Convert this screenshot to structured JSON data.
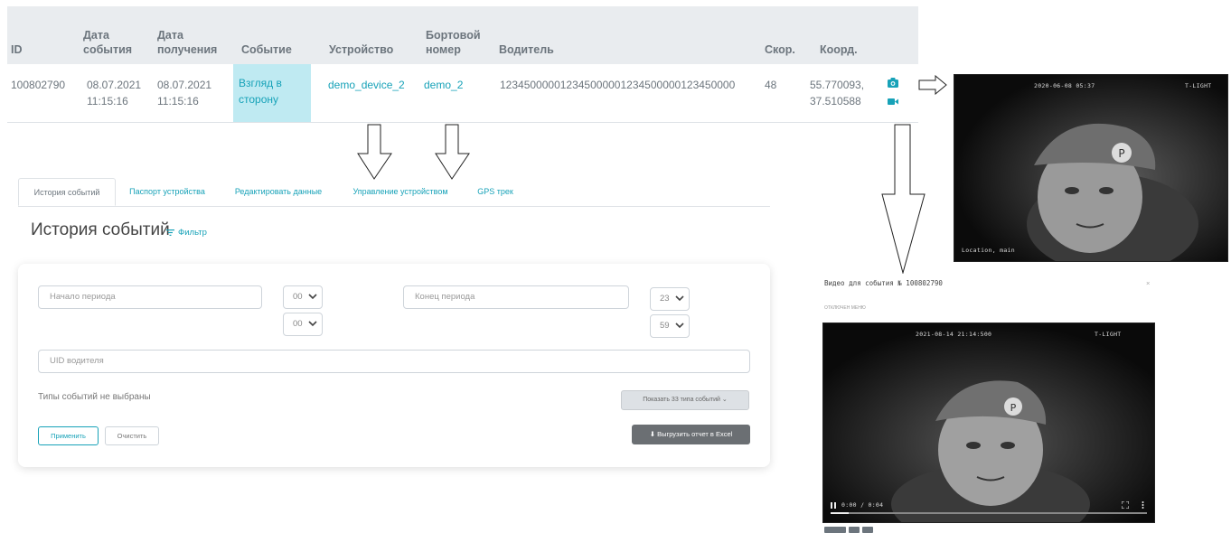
{
  "table": {
    "headers": {
      "id": "ID",
      "event_date_1": "Дата",
      "event_date_2": "события",
      "recv_date_1": "Дата",
      "recv_date_2": "получения",
      "event": "Событие",
      "device": "Устройство",
      "board_1": "Бортовой",
      "board_2": "номер",
      "driver": "Водитель",
      "speed": "Скор.",
      "coords": "Коорд."
    },
    "row": {
      "id": "100802790",
      "event_date": "08.07.2021",
      "event_time": "11:15:16",
      "recv_date": "08.07.2021",
      "recv_time": "11:15:16",
      "event_1": "Взгляд в",
      "event_2": "сторону",
      "device": "demo_device_2",
      "board": "demo_2",
      "driver": "123450000012345000001234500000123450000",
      "speed": "48",
      "lat": "55.770093,",
      "lon": "37.510588"
    }
  },
  "tabs": [
    {
      "label": "История событий"
    },
    {
      "label": "Паспорт устройства"
    },
    {
      "label": "Редактировать данные"
    },
    {
      "label": "Управление устройством"
    },
    {
      "label": "GPS трек"
    }
  ],
  "section": {
    "title": "История событий",
    "filter": "Фильтр"
  },
  "filter": {
    "start_placeholder": "Начало периода",
    "end_placeholder": "Конец периода",
    "start_hour": "00",
    "start_min": "00",
    "end_hour": "23",
    "end_min": "59",
    "uid_placeholder": "UID водителя",
    "types_text": "Типы событий не выбраны",
    "types_button": "Показать 33 типа событий ⌄",
    "apply": "Применить",
    "clear": "Очистить",
    "excel": "⬇ Выгрузить отчет в Excel"
  },
  "photo_top": {
    "timestamp": "2020-06-08 05:37",
    "corner": "T-LIGHT",
    "caption": "Location, main"
  },
  "modal": {
    "title": "Видео для события № 100802790",
    "close": "×",
    "subtitle": "ОТКЛЮЧЕН МЕНЮ"
  },
  "video": {
    "timestamp": "2021-08-14 21:14:500",
    "corner": "T-LIGHT",
    "time": "0:00 / 0:04"
  },
  "colors": {
    "accent": "#17a2b8",
    "header_bg": "#e9ecef",
    "event_bg": "#bfeaf2",
    "excel_btn": "#6b6f73"
  }
}
